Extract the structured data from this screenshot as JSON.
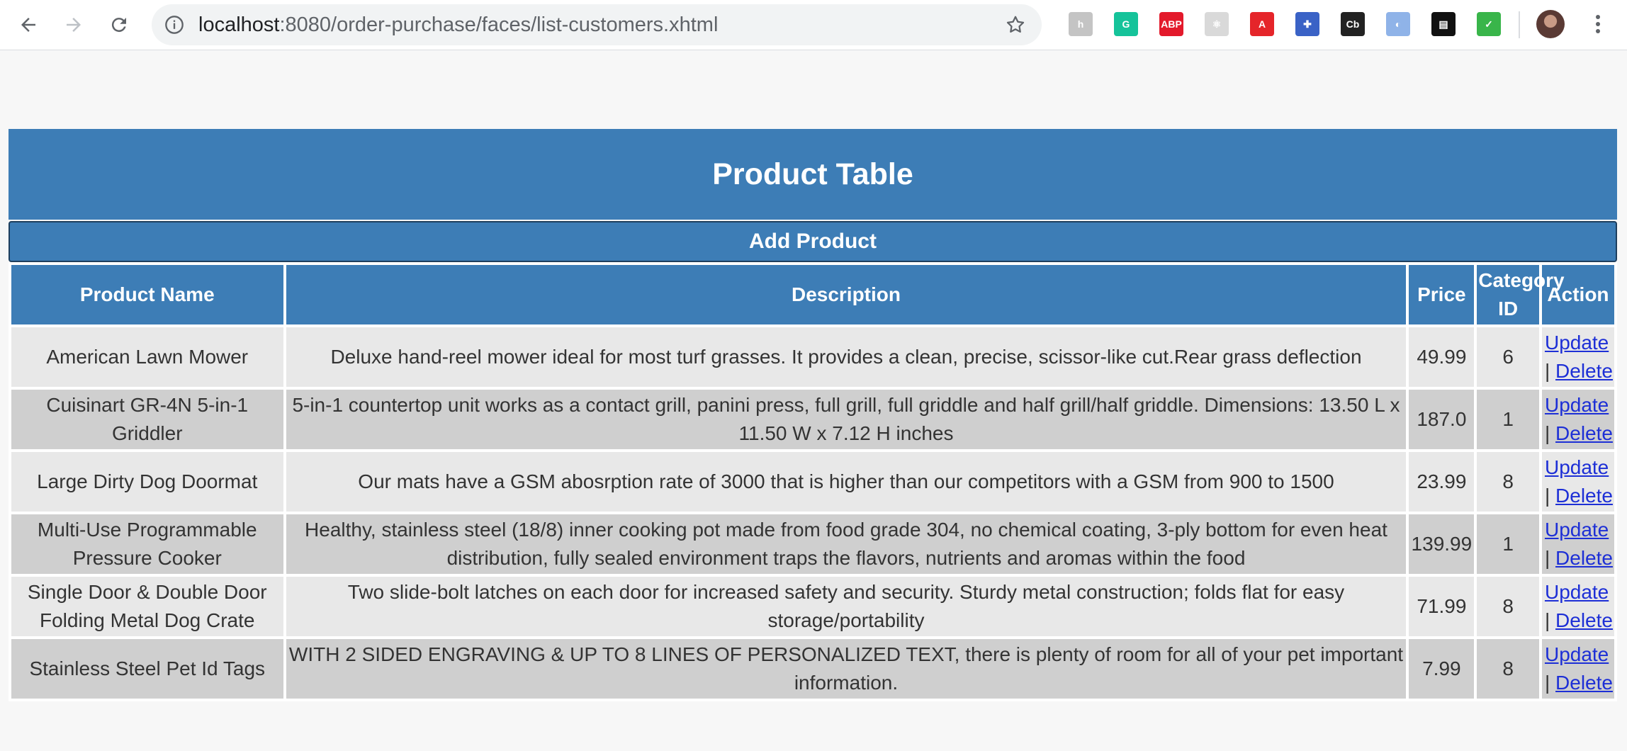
{
  "browser": {
    "url_host": "localhost",
    "url_rest": ":8080/order-purchase/faces/list-customers.xhtml",
    "extensions": [
      {
        "icon": "h-icon",
        "label": "h",
        "color": "#c4c4c4"
      },
      {
        "icon": "grammarly-icon",
        "label": "G",
        "color": "#15c39a"
      },
      {
        "icon": "adblock-icon",
        "label": "ABP",
        "color": "#e3192b"
      },
      {
        "icon": "react-devtools-icon",
        "label": "⚛",
        "color": "#d9d9d9"
      },
      {
        "icon": "acrobat-icon",
        "label": "A",
        "color": "#e5252a"
      },
      {
        "icon": "puzzle-icon",
        "label": "✚",
        "color": "#3a62c6"
      },
      {
        "icon": "cb-icon",
        "label": "Cb",
        "color": "#222222"
      },
      {
        "icon": "drop-icon",
        "label": "◐",
        "color": "#8fb3e8"
      },
      {
        "icon": "doc-icon",
        "label": "▤",
        "color": "#111111"
      },
      {
        "icon": "shield-check-icon",
        "label": "✓",
        "color": "#39b54a"
      }
    ]
  },
  "page": {
    "title": "Product Table",
    "add_button": "Add Product",
    "accent_color": "#3d7db6"
  },
  "table": {
    "headers": [
      "Product Name",
      "Description",
      "Price",
      "Category ID",
      "Action"
    ],
    "update_label": "Update",
    "delete_label": "Delete",
    "separator": "|",
    "rows": [
      {
        "name": "American Lawn Mower",
        "description": "Deluxe hand-reel mower ideal for most turf grasses. It provides a clean, precise, scissor-like cut.Rear grass deflection",
        "price": "49.99",
        "category": "6"
      },
      {
        "name": "Cuisinart GR-4N 5-in-1 Griddler",
        "description": "5-in-1 countertop unit works as a contact grill, panini press, full grill, full griddle and half grill/half griddle. Dimensions: 13.50 L x 11.50 W x 7.12 H inches",
        "price": "187.0",
        "category": "1"
      },
      {
        "name": "Large Dirty Dog Doormat",
        "description": "Our mats have a GSM abosrption rate of 3000 that is higher than our competitors with a GSM from 900 to 1500",
        "price": "23.99",
        "category": "8"
      },
      {
        "name": "Multi-Use Programmable Pressure Cooker",
        "description": "Healthy, stainless steel (18/8) inner cooking pot made from food grade 304, no chemical coating, 3-ply bottom for even heat distribution, fully sealed environment traps the flavors, nutrients and aromas within the food",
        "price": "139.99",
        "category": "1"
      },
      {
        "name": "Single Door & Double Door Folding Metal Dog Crate",
        "description": "Two slide-bolt latches on each door for increased safety and security. Sturdy metal construction; folds flat for easy storage/portability",
        "price": "71.99",
        "category": "8"
      },
      {
        "name": "Stainless Steel Pet Id Tags",
        "description": "WITH 2 SIDED ENGRAVING & UP TO 8 LINES OF PERSONALIZED TEXT, there is plenty of room for all of your pet important information.",
        "price": "7.99",
        "category": "8"
      }
    ]
  }
}
